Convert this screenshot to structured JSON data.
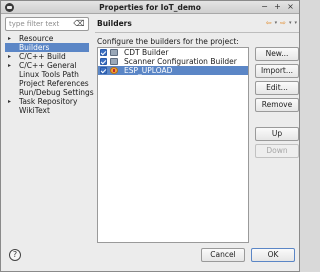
{
  "window": {
    "title": "Properties for IoT_demo",
    "controls": [
      "−",
      "+",
      "×"
    ]
  },
  "sidebar": {
    "filter_placeholder": "type filter text",
    "items": [
      {
        "label": "Resource",
        "arrow": "▸",
        "selected": false
      },
      {
        "label": "Builders",
        "arrow": "",
        "selected": true
      },
      {
        "label": "C/C++ Build",
        "arrow": "▸",
        "selected": false
      },
      {
        "label": "C/C++ General",
        "arrow": "▸",
        "selected": false
      },
      {
        "label": "Linux Tools Path",
        "arrow": "",
        "selected": false
      },
      {
        "label": "Project References",
        "arrow": "",
        "selected": false
      },
      {
        "label": "Run/Debug Settings",
        "arrow": "",
        "selected": false
      },
      {
        "label": "Task Repository",
        "arrow": "▸",
        "selected": false
      },
      {
        "label": "WikiText",
        "arrow": "",
        "selected": false
      }
    ]
  },
  "page": {
    "title": "Builders",
    "description": "Configure the builders for the project:",
    "nav": {
      "back": "⇦",
      "forward": "⇨",
      "menu": "▾"
    },
    "builders": [
      {
        "label": "CDT Builder",
        "checked": true,
        "icon": "gear-icon",
        "selected": false
      },
      {
        "label": "Scanner Configuration Builder",
        "checked": true,
        "icon": "gear-icon",
        "selected": false
      },
      {
        "label": "ESP_UPLOAD",
        "checked": true,
        "icon": "external-tool-icon",
        "selected": true
      }
    ],
    "buttons": {
      "new": "New...",
      "import": "Import...",
      "edit": "Edit...",
      "remove": "Remove",
      "up": "Up",
      "down": "Down"
    }
  },
  "footer": {
    "help": "?",
    "cancel": "Cancel",
    "ok": "OK"
  }
}
